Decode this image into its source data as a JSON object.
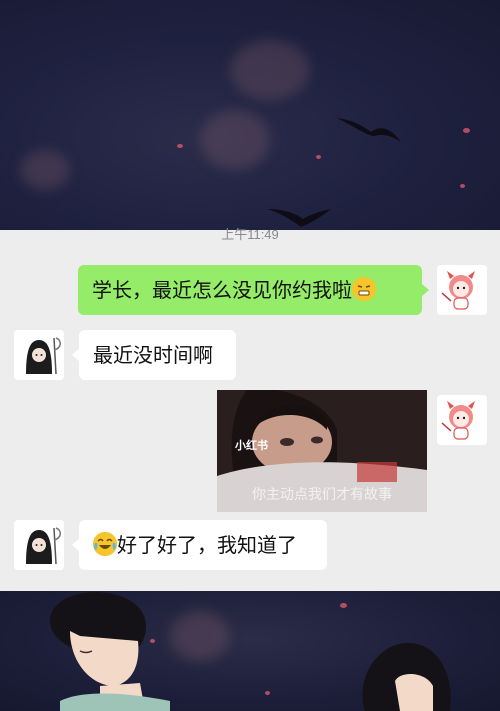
{
  "chat": {
    "timestamp": "上午11:49",
    "messages": [
      {
        "side": "me",
        "text": "学长，最近怎么没见你约我啦",
        "emoji": "grimace-emoji"
      },
      {
        "side": "other",
        "text": "最近没时间啊"
      },
      {
        "side": "me",
        "media": {
          "watermark": "小红书",
          "caption": "你主动点我们才有故事"
        }
      },
      {
        "side": "other",
        "text": "好了好了，我知道了",
        "emoji": "laugh-cry-emoji"
      }
    ]
  },
  "colors": {
    "my_bubble": "#95ec69",
    "their_bubble": "#ffffff",
    "chat_background": "#ededed",
    "banner_night": "#1f2240"
  }
}
